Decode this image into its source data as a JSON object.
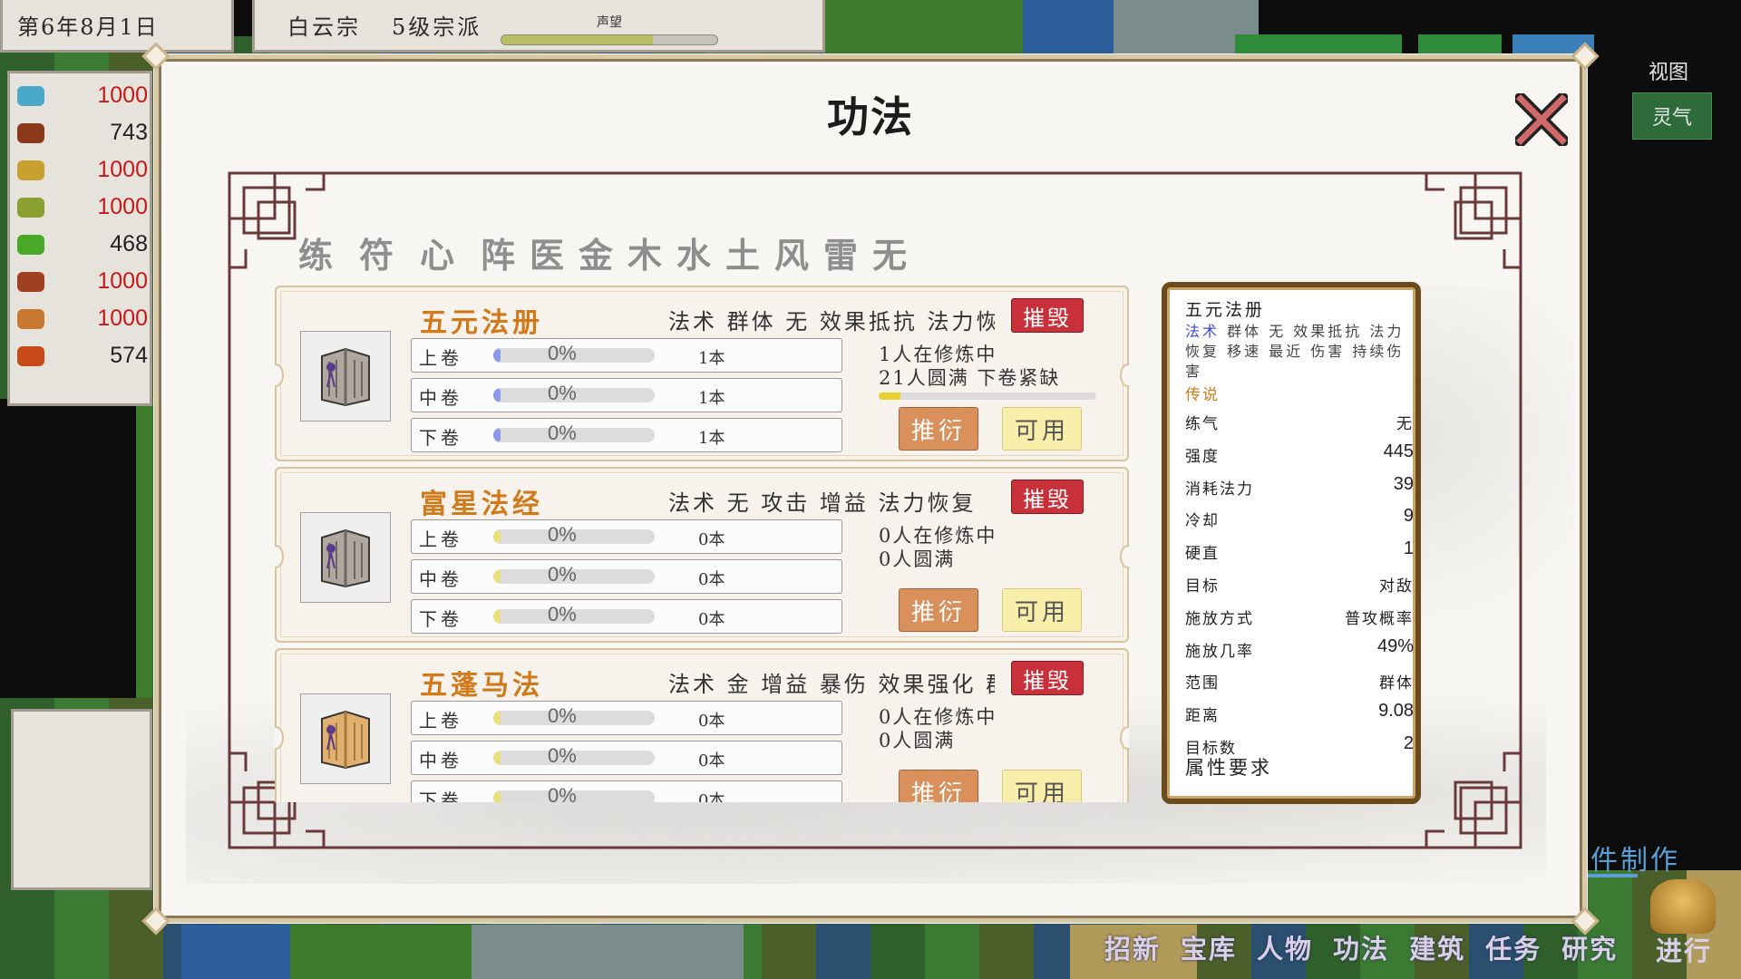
{
  "topbar": {
    "date": "第6年8月1日",
    "sect_name": "白云宗",
    "sect_level": "5级宗派",
    "reputation_label": "声望",
    "reputation_progress": 0.7
  },
  "resources": [
    {
      "icon": "ore-icon",
      "color": "#4aa8c8",
      "value": "1000",
      "value_color": "#c81818"
    },
    {
      "icon": "chest-icon",
      "color": "#8a3a1a",
      "value": "743",
      "value_color": "#222222"
    },
    {
      "icon": "leaf-icon",
      "color": "#c8a030",
      "value": "1000",
      "value_color": "#c81818"
    },
    {
      "icon": "pod-icon",
      "color": "#8aa030",
      "value": "1000",
      "value_color": "#c81818"
    },
    {
      "icon": "herb-icon",
      "color": "#48a828",
      "value": "468",
      "value_color": "#222222"
    },
    {
      "icon": "beast-hide-icon",
      "color": "#a04020",
      "value": "1000",
      "value_color": "#c81818"
    },
    {
      "icon": "wood-icon",
      "color": "#c87830",
      "value": "1000",
      "value_color": "#c81818"
    },
    {
      "icon": "food-icon",
      "color": "#c84a1a",
      "value": "574",
      "value_color": "#222222"
    }
  ],
  "right_side": {
    "view_label": "视图",
    "lingqi_label": "灵气",
    "craft_label": "件制作"
  },
  "bottom_nav": [
    "招新",
    "宝库",
    "人物",
    "功法",
    "建筑",
    "任务",
    "研究"
  ],
  "go_label": "进行",
  "modal": {
    "title": "功法",
    "categories": [
      "练气",
      "符",
      "心法",
      "阵",
      "医",
      "金",
      "木",
      "水",
      "土",
      "风",
      "雷",
      "无"
    ],
    "books": [
      {
        "name": "五元法册",
        "desc": "法术 群体 无 效果抵抗 法力恢复",
        "destroy": "摧毁",
        "volumes": [
          {
            "name": "上卷",
            "pct": "0%",
            "count": "1本",
            "color": "#8a9ae8"
          },
          {
            "name": "中卷",
            "pct": "0%",
            "count": "1本",
            "color": "#8a9ae8"
          },
          {
            "name": "下卷",
            "pct": "0%",
            "count": "1本",
            "color": "#8a9ae8"
          }
        ],
        "status1": "1人在修炼中",
        "status2": "21人圆满 下卷紧缺",
        "progress": 0.1,
        "derive": "推衍",
        "usable": "可用"
      },
      {
        "name": "富星法经",
        "desc": "法术 无 攻击 增益 法力恢复",
        "destroy": "摧毁",
        "volumes": [
          {
            "name": "上卷",
            "pct": "0%",
            "count": "0本",
            "color": "#e8e07a"
          },
          {
            "name": "中卷",
            "pct": "0%",
            "count": "0本",
            "color": "#e8e07a"
          },
          {
            "name": "下卷",
            "pct": "0%",
            "count": "0本",
            "color": "#e8e07a"
          }
        ],
        "status1": "0人在修炼中",
        "status2": "0人圆满",
        "derive": "推衍",
        "usable": "可用"
      },
      {
        "name": "五蓬马法",
        "desc": "法术 金 增益 暴伤 效果强化 群",
        "destroy": "摧毁",
        "volumes": [
          {
            "name": "上卷",
            "pct": "0%",
            "count": "0本",
            "color": "#e8e07a"
          },
          {
            "name": "中卷",
            "pct": "0%",
            "count": "0本",
            "color": "#e8e07a"
          },
          {
            "name": "下卷",
            "pct": "0%",
            "count": "0本",
            "color": "#e8e07a"
          }
        ],
        "status1": "0人在修炼中",
        "status2": "0人圆满",
        "derive": "推衍",
        "usable": "可用"
      }
    ],
    "detail": {
      "name": "五元法册",
      "desc_highlight": "法术",
      "desc_rest": " 群体 无 效果抵抗 法力恢复 移速 最近 伤害 持续伤害",
      "grade": "传说",
      "rows": [
        {
          "k": "练气",
          "v": "无",
          "cn": true
        },
        {
          "k": "强度",
          "v": "445"
        },
        {
          "k": "消耗法力",
          "v": "39"
        },
        {
          "k": "冷却",
          "v": "9"
        },
        {
          "k": "硬直",
          "v": "1"
        },
        {
          "k": "目标",
          "v": "对敌",
          "cn": true
        },
        {
          "k": "施放方式",
          "v": "普攻概率",
          "cn": true
        },
        {
          "k": "施放几率",
          "v": "49%"
        },
        {
          "k": "范围",
          "v": "群体",
          "cn": true
        },
        {
          "k": "距离",
          "v": "9.08"
        },
        {
          "k": "目标数",
          "v": "2"
        }
      ],
      "attr_req": "属性要求"
    }
  }
}
